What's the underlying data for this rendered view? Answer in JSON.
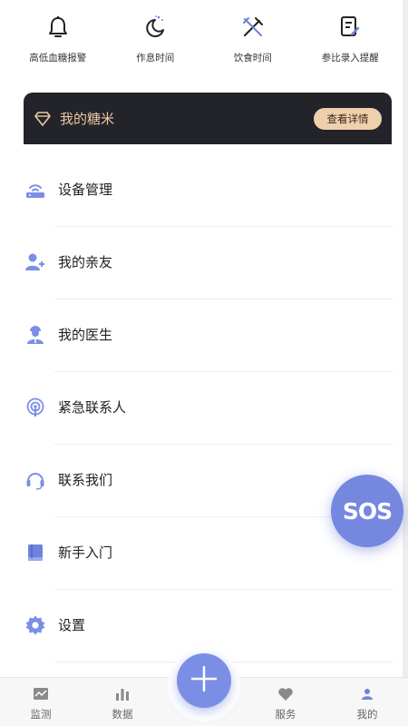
{
  "shortcuts": [
    {
      "label": "高低血糖报警",
      "icon": "bell-icon"
    },
    {
      "label": "作息时间",
      "icon": "moon-icon"
    },
    {
      "label": "饮食时间",
      "icon": "utensils-icon"
    },
    {
      "label": "参比录入提醒",
      "icon": "edit-note-icon"
    }
  ],
  "banner": {
    "title": "我的糖米",
    "detail_button": "查看详情",
    "icon": "diamond-icon",
    "accent_color": "#e9c9a3"
  },
  "menu": [
    {
      "label": "设备管理",
      "icon": "router-icon"
    },
    {
      "label": "我的亲友",
      "icon": "add-friend-icon"
    },
    {
      "label": "我的医生",
      "icon": "doctor-icon"
    },
    {
      "label": "紧急联系人",
      "icon": "broadcast-icon"
    },
    {
      "label": "联系我们",
      "icon": "headset-icon"
    },
    {
      "label": "新手入门",
      "icon": "book-icon"
    },
    {
      "label": "设置",
      "icon": "settings-icon"
    }
  ],
  "sos": {
    "label": "SOS",
    "color": "#7687e0"
  },
  "tabbar": {
    "tabs": [
      {
        "label": "监测",
        "icon": "monitor-icon"
      },
      {
        "label": "数据",
        "icon": "bar-chart-icon"
      },
      {
        "label": "服务",
        "icon": "heart-hand-icon"
      },
      {
        "label": "我的",
        "icon": "person-icon",
        "active": true
      }
    ],
    "fab_icon": "plus-icon"
  },
  "colors": {
    "accent": "#7b8ee6",
    "banner_bg": "#23232a",
    "button_gold": "#eed0ac"
  }
}
